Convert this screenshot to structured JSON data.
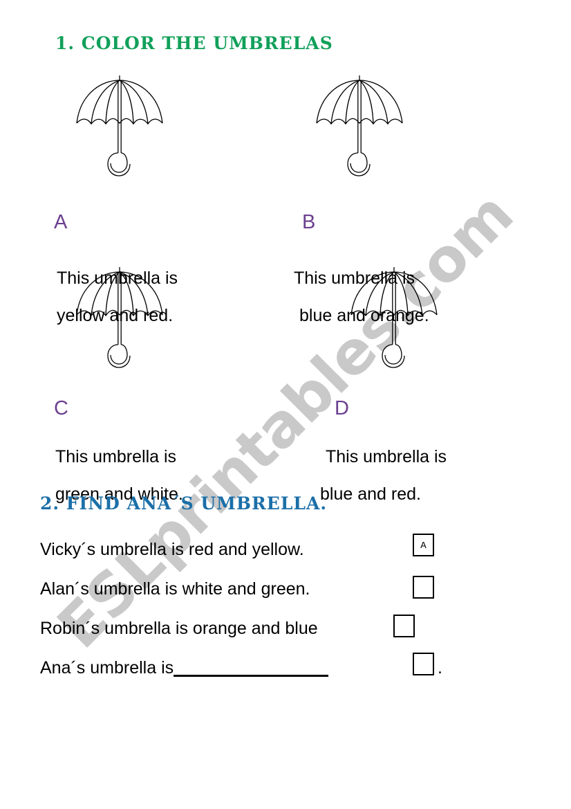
{
  "watermark": {
    "text": "ESLprintables.com",
    "color": "#c9c9c9"
  },
  "exercise_1": {
    "heading": "1. COLOR THE UMBRELAS",
    "heading_color": "#11a05a",
    "letter_color": "#6b3f8f",
    "items": [
      {
        "letter": "A",
        "icon": "umbrella-icon",
        "line_1": "This umbrella is",
        "line_2": "yellow and red."
      },
      {
        "letter": "B",
        "icon": "umbrella-icon",
        "line_1": "This umbrella is",
        "line_2": "blue and orange."
      },
      {
        "letter": "C",
        "icon": "umbrella-icon",
        "line_1": "This umbrella is",
        "line_2": "green and white."
      },
      {
        "letter": "D",
        "icon": "umbrella-icon",
        "line_1": "This umbrella is",
        "line_2": "blue and red."
      }
    ]
  },
  "exercise_2": {
    "heading": "2.    FIND ANA´S UMBRELLA.",
    "heading_color": "#1b6fa8",
    "questions": [
      {
        "text": "Vicky´s umbrella is red and yellow.",
        "answer": "A"
      },
      {
        "text": "Alan´s umbrella is white and green.",
        "answer": ""
      },
      {
        "text": "Robin´s umbrella is orange and blue",
        "answer": ""
      },
      {
        "text": "Ana´s umbrella is",
        "answer": "",
        "trailing": "."
      }
    ]
  }
}
